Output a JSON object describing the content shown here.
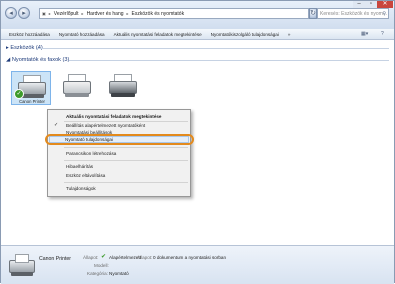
{
  "address": {
    "segments": [
      "Vezérlőpult",
      "Hardver és hang",
      "Eszközök és nyomtatók"
    ],
    "separator": "▸"
  },
  "search": {
    "placeholder": "Keresés: Eszközök és nyom..."
  },
  "toolbar": {
    "items": [
      "Eszköz hozzáadása",
      "Nyomtató hozzáadása",
      "Aktuális nyomtatási feladatok megtekintése",
      "Nyomtatókiszolgáló tulajdonságai"
    ],
    "chevron": "»"
  },
  "groups": {
    "devices": "Eszközök (4)",
    "printers": "Nyomtatók és faxok (3)"
  },
  "printers": [
    {
      "name": "Canon Printer",
      "selected": true,
      "default": true
    },
    {
      "name": "",
      "selected": false
    },
    {
      "name": "",
      "selected": false
    }
  ],
  "context_menu": {
    "items": [
      {
        "label": "Aktuális nyomtatási feladatok megtekintése",
        "bold": true
      },
      {
        "label": "Beállítás alapértelmezett nyomtatóként",
        "checked": true
      },
      {
        "label": "Nyomtatási beállítások"
      },
      {
        "label": "Nyomtató tulajdonságai",
        "highlighted": true
      },
      {
        "label": "Parancsikon létrehozása"
      },
      {
        "label": "Hibaelhárítás"
      },
      {
        "label": "Eszköz eltávolítása"
      },
      {
        "label": "Tulajdonságok"
      }
    ]
  },
  "details": {
    "name": "Canon Printer",
    "state_label": "Állapot:",
    "state_value": "Alapértelmezett",
    "model_label": "Modell:",
    "category_label": "Kategória:",
    "category_value": "Nyomtató",
    "status_label": "Állapot:",
    "status_value": "0 dokumentum a nyomtatási sorban"
  },
  "colors": {
    "highlight": "#e38a1d",
    "selection": "#cce4f7",
    "link": "#1e3b7a"
  }
}
